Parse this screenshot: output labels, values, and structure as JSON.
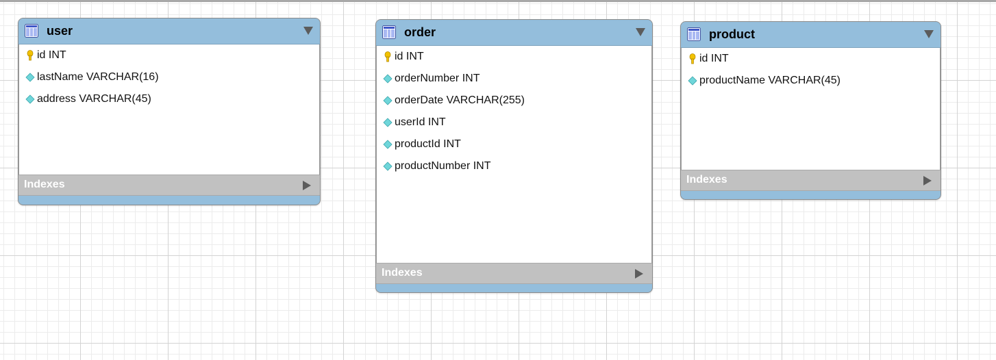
{
  "tables": [
    {
      "name": "user",
      "columns": [
        {
          "label": "id INT",
          "key": true
        },
        {
          "label": "lastName VARCHAR(16)",
          "key": false
        },
        {
          "label": "address VARCHAR(45)",
          "key": false
        }
      ],
      "indexes_label": "Indexes"
    },
    {
      "name": "order",
      "columns": [
        {
          "label": "id INT",
          "key": true
        },
        {
          "label": "orderNumber INT",
          "key": false
        },
        {
          "label": "orderDate VARCHAR(255)",
          "key": false
        },
        {
          "label": "userId INT",
          "key": false
        },
        {
          "label": "productId INT",
          "key": false
        },
        {
          "label": "productNumber INT",
          "key": false
        }
      ],
      "indexes_label": "Indexes"
    },
    {
      "name": "product",
      "columns": [
        {
          "label": "id INT",
          "key": true
        },
        {
          "label": "productName VARCHAR(45)",
          "key": false
        }
      ],
      "indexes_label": "Indexes"
    }
  ],
  "colors": {
    "header": "#94bedc",
    "indexes": "#c1c1c1",
    "key_icon": "#f2c200",
    "column_icon": "#6fd6da"
  },
  "icons": {
    "table": "table-grid-icon",
    "collapse": "triangle-down-icon",
    "primary_key": "key-icon",
    "column": "diamond-icon",
    "indexes_expand": "triangle-right-icon"
  }
}
